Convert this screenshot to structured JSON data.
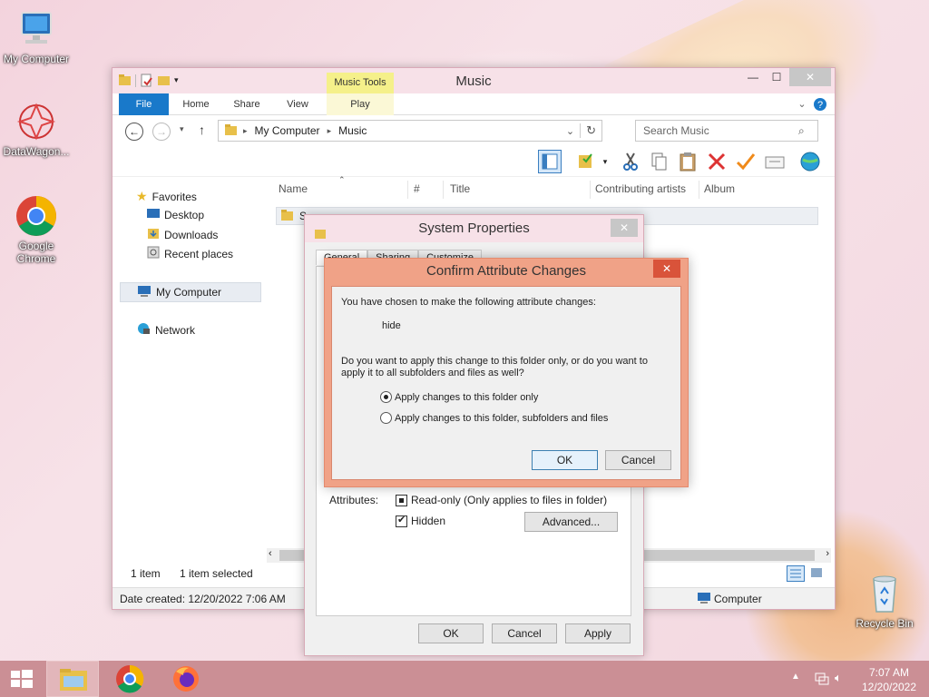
{
  "desktop": {
    "icons": [
      {
        "label": "My Computer"
      },
      {
        "label": "DataWagon..."
      },
      {
        "label": "Google Chrome"
      },
      {
        "label": "Recycle Bin"
      }
    ]
  },
  "explorer": {
    "title": "Music",
    "contextual_tab_group": "Music Tools",
    "tabs": {
      "file": "File",
      "home": "Home",
      "share": "Share",
      "view": "View",
      "play": "Play"
    },
    "address": {
      "crumbs": [
        "My Computer",
        "Music"
      ]
    },
    "search_placeholder": "Search Music",
    "nav": {
      "favorites": "Favorites",
      "desktop": "Desktop",
      "downloads": "Downloads",
      "recent": "Recent places",
      "my_computer": "My Computer",
      "network": "Network"
    },
    "columns": {
      "name": "Name",
      "number": "#",
      "title": "Title",
      "artists": "Contributing artists",
      "album": "Album"
    },
    "row_name_partial": "S",
    "status": {
      "items": "1 item",
      "selected": "1 item selected",
      "date_created": "Date created: 12/20/2022 7:06 AM",
      "location": "Computer"
    }
  },
  "system_properties": {
    "title": "System Properties",
    "tabs": [
      "General",
      "Sharing",
      "Customize"
    ],
    "attributes_label": "Attributes:",
    "readonly_label": "Read-only (Only applies to files in folder)",
    "hidden_label": "Hidden",
    "hidden_checked": true,
    "advanced_button": "Advanced...",
    "ok": "OK",
    "cancel": "Cancel",
    "apply": "Apply"
  },
  "confirm": {
    "title": "Confirm Attribute Changes",
    "intro": "You have chosen to make the following attribute changes:",
    "change": "hide",
    "question_line1": "Do you want to apply this change to this folder only, or do you want to",
    "question_line2": "apply it to all subfolders and files as well?",
    "option1": "Apply changes to this folder only",
    "option2": "Apply changes to this folder, subfolders and files",
    "selected_option": 1,
    "ok": "OK",
    "cancel": "Cancel"
  },
  "taskbar": {
    "time": "7:07 AM",
    "date": "12/20/2022"
  },
  "colors": {
    "accent": "#1979ca",
    "dialog_frame": "#f0a287",
    "taskbar": "#cb8f95"
  }
}
